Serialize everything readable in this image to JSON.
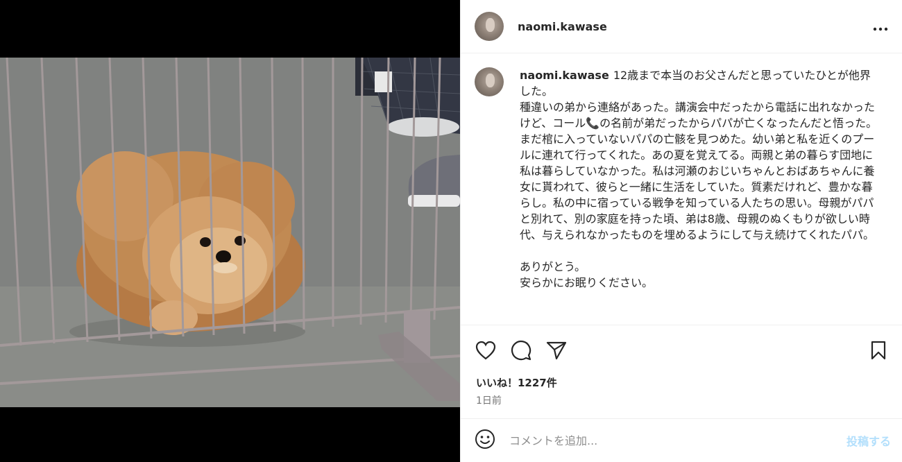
{
  "post": {
    "username": "naomi.kawase",
    "more_label": "•••",
    "caption_user": "naomi.kawase",
    "caption": "12歳まで本当のお父さんだと思っていたひとが他界した。\n種違いの弟から連絡があった。講演会中だったから電話に出れなかったけど、コール📞の名前が弟だったからパパが亡くなったんだと悟った。まだ棺に入っていないパパの亡骸を見つめた。幼い弟と私を近くのプールに連れて行ってくれた。あの夏を覚えてる。両親と弟の暮らす団地に私は暮らしていなかった。私は河瀬のおじいちゃんとおばあちゃんに養女に貰われて、彼らと一緒に生活をしていた。質素だけれど、豊かな暮らし。私の中に宿っている戦争を知っている人たちの思い。母親がパパと別れて、別の家庭を持った頃、弟は8歳、母親のぬくもりが欲しい時代、与えられなかったものを埋めるようにして与え続けてくれたパパ。\n\nありがとう。\n安らかにお眠りください。",
    "likes": "いいね！1227件",
    "timestamp": "1日前"
  },
  "icons": {
    "like": "heart-icon",
    "comment": "comment-icon",
    "share": "share-icon",
    "save": "bookmark-icon",
    "emoji": "emoji-icon",
    "more": "more-icon"
  },
  "comment_box": {
    "placeholder": "コメントを追加...",
    "post_label": "投稿する"
  },
  "colors": {
    "link_disabled": "#b2dffc",
    "text": "#262626",
    "muted": "#737373"
  }
}
